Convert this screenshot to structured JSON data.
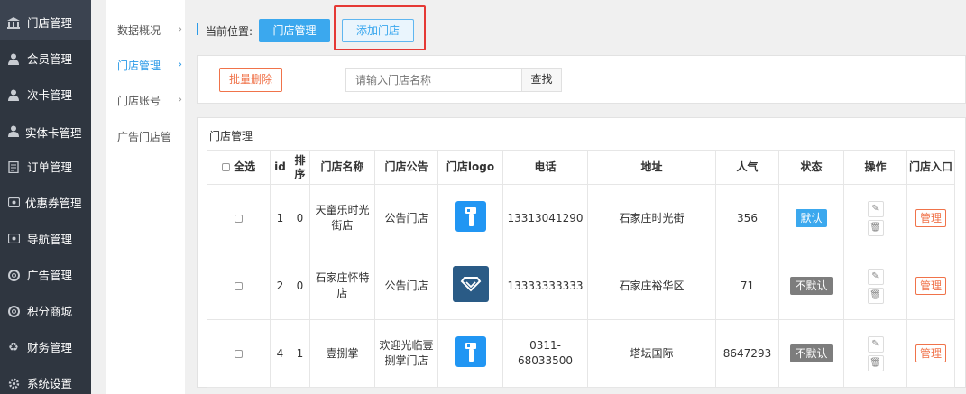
{
  "sidebar": {
    "items": [
      {
        "label": "门店管理",
        "icon": "bank-icon"
      },
      {
        "label": "会员管理",
        "icon": "user-icon"
      },
      {
        "label": "次卡管理",
        "icon": "user-icon"
      },
      {
        "label": "实体卡管理",
        "icon": "user-icon"
      },
      {
        "label": "订单管理",
        "icon": "document-icon"
      },
      {
        "label": "优惠券管理",
        "icon": "ticket-icon"
      },
      {
        "label": "导航管理",
        "icon": "ticket-icon"
      },
      {
        "label": "广告管理",
        "icon": "lifebuoy-icon"
      },
      {
        "label": "积分商城",
        "icon": "lifebuoy-icon"
      },
      {
        "label": "财务管理",
        "icon": "recycle-icon"
      },
      {
        "label": "系统设置",
        "icon": "gear-icon"
      }
    ]
  },
  "submenu": {
    "items": [
      {
        "label": "数据概况",
        "arrow": "›"
      },
      {
        "label": "门店管理",
        "arrow": "›"
      },
      {
        "label": "门店账号",
        "arrow": "›"
      },
      {
        "label": "广告门店管",
        "arrow": ""
      }
    ]
  },
  "breadcrumb": {
    "label": "当前位置:",
    "current": "门店管理",
    "add_button": "添加门店"
  },
  "toolbar": {
    "batch_delete": "批量删除",
    "search_placeholder": "请输入门店名称",
    "search_button": "查找"
  },
  "panel": {
    "title": "门店管理"
  },
  "table": {
    "headers": {
      "select_all": "全选",
      "id": "id",
      "sort": "排序",
      "name": "门店名称",
      "notice": "门店公告",
      "logo": "门店logo",
      "phone": "电话",
      "address": "地址",
      "popularity": "人气",
      "status": "状态",
      "action": "操作",
      "entry": "门店入口"
    },
    "rows": [
      {
        "id": "1",
        "sort": "0",
        "name": "天童乐时光街店",
        "notice": "公告门店",
        "logo": "blue-brush-logo",
        "phone": "13313041290",
        "address": "石家庄时光街",
        "popularity": "356",
        "status": "默认",
        "manage": "管理"
      },
      {
        "id": "2",
        "sort": "0",
        "name": "石家庄怀特店",
        "notice": "公告门店",
        "logo": "diamond-logo",
        "phone": "13333333333",
        "address": "石家庄裕华区",
        "popularity": "71",
        "status": "不默认",
        "manage": "管理"
      },
      {
        "id": "4",
        "sort": "1",
        "name": "壹捌掌",
        "notice": "欢迎光临壹捌掌门店",
        "logo": "blue-brush-logo",
        "phone": "0311-68033500",
        "address": "塔坛国际",
        "popularity": "8647293",
        "status": "不默认",
        "manage": "管理"
      }
    ]
  },
  "colors": {
    "sidebar_bg": "#2f3640",
    "accent": "#3ba8ee",
    "danger": "#f0734a",
    "highlight_box": "#e53935"
  }
}
